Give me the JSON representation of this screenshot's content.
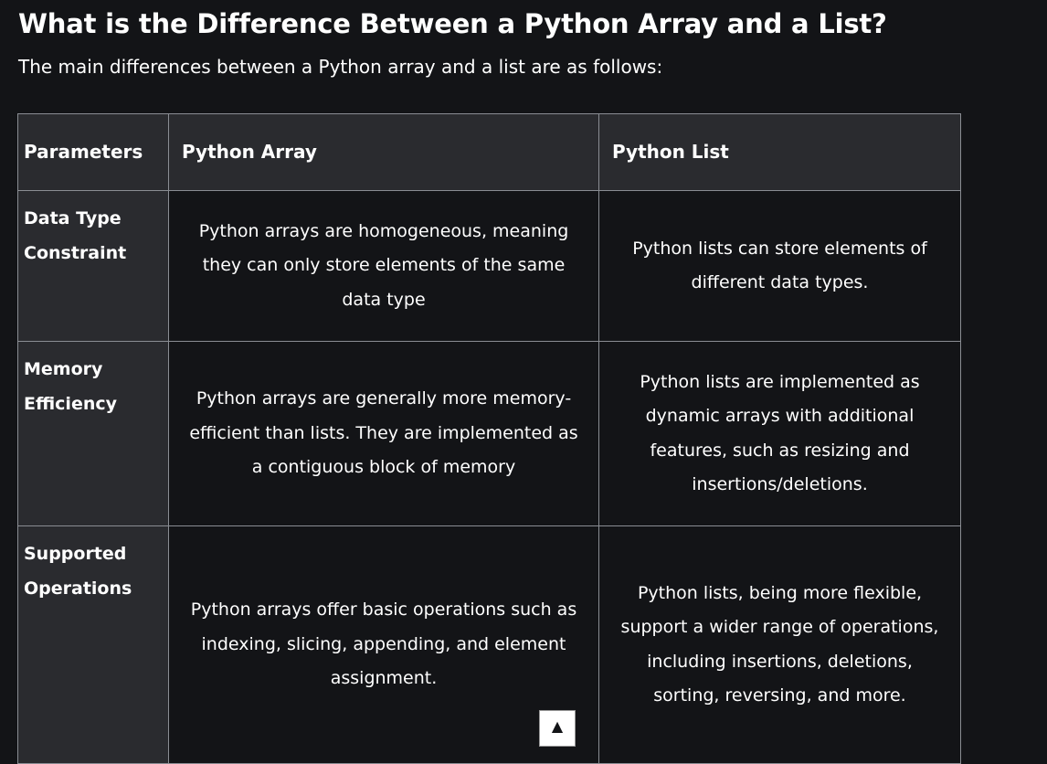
{
  "article": {
    "heading": "What is the Difference Between a Python Array and a List?",
    "intro": "The main differences between a Python array and a list are as follows:"
  },
  "table": {
    "headers": [
      "Parameters",
      "Python Array",
      "Python List"
    ],
    "rows": [
      {
        "parameter": "Data Type Constraint",
        "array": "Python arrays are homogeneous, meaning they can only store elements of the same data type",
        "list": "Python lists can store elements of different data types."
      },
      {
        "parameter": "Memory Efficiency",
        "array": "Python arrays are generally more memory-efficient than lists. They are implemented as a contiguous block of memory",
        "list": "Python lists are implemented as dynamic arrays with additional features, such as resizing and insertions/deletions."
      },
      {
        "parameter": "Supported Operations",
        "array": "Python arrays offer basic operations such as indexing, slicing, appending, and element assignment.",
        "list": "Python lists, being more flexible, support a wider range of operations, including insertions, deletions, sorting, reversing, and more."
      }
    ]
  },
  "scroll_top": {
    "icon": "caret-up-icon",
    "glyph": "▲"
  }
}
